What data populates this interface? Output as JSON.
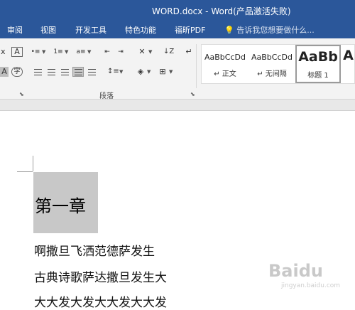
{
  "window": {
    "title": "WORD.docx - Word(产品激活失败)"
  },
  "menu": {
    "items": [
      "审阅",
      "视图",
      "开发工具",
      "特色功能",
      "福昕PDF"
    ],
    "tell_me_placeholder": "告诉我您想要做什么..."
  },
  "ribbon": {
    "group_label": "段落",
    "styles": [
      {
        "sample": "AaBbCcDd",
        "name": "↵ 正文"
      },
      {
        "sample": "AaBbCcDd",
        "name": "↵ 无间隔"
      },
      {
        "sample": "AaBb",
        "name": "标题 1"
      },
      {
        "sample": "A",
        "name": ""
      }
    ]
  },
  "document": {
    "heading": "第一章",
    "paragraphs": [
      "啊撒旦飞洒范德萨发生",
      "古典诗歌萨达撒旦发生大",
      "大大发大发大大发大大发"
    ]
  },
  "watermark": {
    "text": "Baidu",
    "sub": "jingyan.baidu.com"
  },
  "colors": {
    "accent": "#2b579a",
    "selection": "#c8c8c8"
  }
}
